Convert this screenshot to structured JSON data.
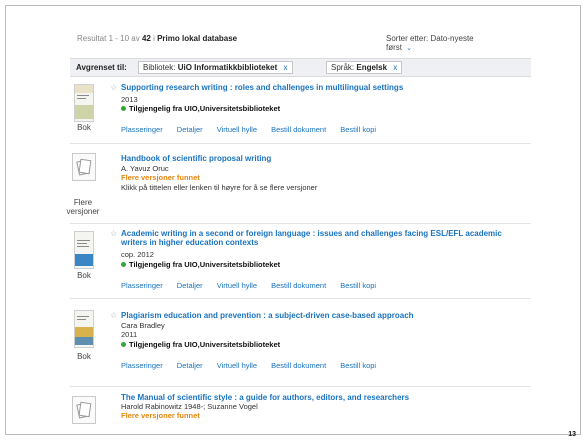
{
  "page_number": "13",
  "results": {
    "prefix": "Resultat 1 - 10 av",
    "total": "42",
    "in_label": "i",
    "source": "Primo lokal database"
  },
  "sort": {
    "label": "Sorter etter:",
    "value": "Dato-nyeste",
    "value2": "først"
  },
  "filters": {
    "label": "Avgrenset til:",
    "chips": [
      {
        "key": "Bibliotek:",
        "value": "UiO Informatikkbiblioteket",
        "remove": "x"
      },
      {
        "key": "Språk:",
        "value": "Engelsk",
        "remove": "x"
      }
    ]
  },
  "records": [
    {
      "type": "Bok",
      "title": "Supporting research writing : roles and challenges in multilingual settings",
      "year": "2013",
      "availability": "Tilgjengelig fra UIO,Universitetsbiblioteket",
      "tabs": [
        "Plasseringer",
        "Detaljer",
        "Virtuell hylle",
        "Bestill dokument",
        "Bestill kopi"
      ]
    },
    {
      "type": "Flere versjoner",
      "title": "Handbook of scientific proposal writing",
      "author": "A. Yavuz Oruc",
      "versions": "Flere versjoner funnet",
      "note": "Klikk på tittelen eller lenken til høyre for å se flere versjoner"
    },
    {
      "type": "Bok",
      "title": "Academic writing in a second or foreign language : issues and challenges facing ESL/EFL academic writers in higher education contexts",
      "year": "cop. 2012",
      "availability": "Tilgjengelig fra UIO,Universitetsbiblioteket",
      "tabs": [
        "Plasseringer",
        "Detaljer",
        "Virtuell hylle",
        "Bestill dokument",
        "Bestill kopi"
      ]
    },
    {
      "type": "Bok",
      "title": "Plagiarism education and prevention : a subject-driven case-based approach",
      "author": "Cara Bradley",
      "year": "2011",
      "availability": "Tilgjengelig fra UIO,Universitetsbiblioteket",
      "tabs": [
        "Plasseringer",
        "Detaljer",
        "Virtuell hylle",
        "Bestill dokument",
        "Bestill kopi"
      ]
    },
    {
      "title": "The Manual of scientific style : a guide for authors, editors, and researchers",
      "author": "Harold Rabinowitz 1948-; Suzanne Vogel",
      "versions": "Flere versjoner funnet"
    }
  ],
  "colors": {
    "link": "#1a73c0",
    "available": "#2fa83a",
    "versions": "#e8850c",
    "filter_bar": "#eef0f3"
  },
  "icons": [
    "star-icon",
    "availability-dot-icon",
    "chevron-down-icon",
    "versions-icon",
    "book-cover-thumbnail"
  ]
}
